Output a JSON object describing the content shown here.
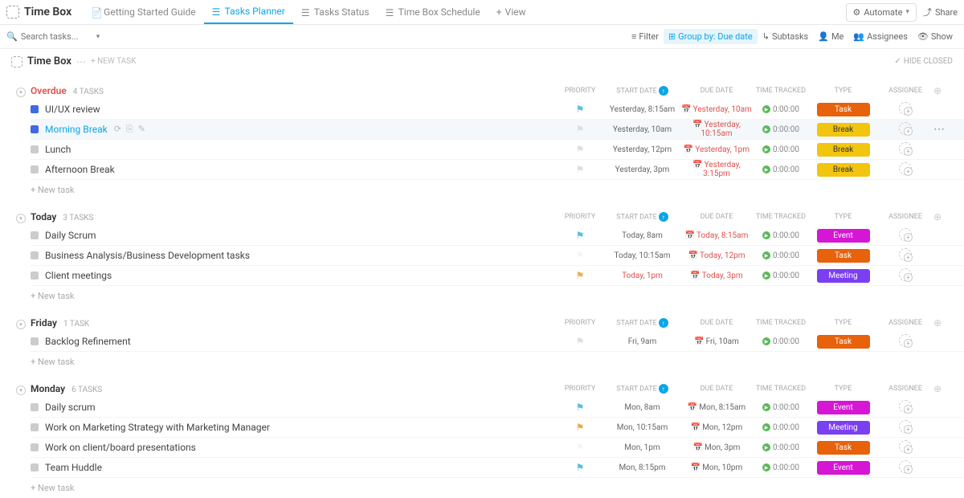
{
  "header": {
    "space_title": "Time Box",
    "tabs": [
      {
        "label": "Getting Started Guide"
      },
      {
        "label": "Tasks Planner"
      },
      {
        "label": "Tasks Status"
      },
      {
        "label": "Time Box Schedule"
      },
      {
        "label": "View"
      }
    ],
    "automate": "Automate",
    "share": "Share"
  },
  "toolbar": {
    "search_placeholder": "Search tasks...",
    "filter": "Filter",
    "group_by": "Group by: Due date",
    "subtasks": "Subtasks",
    "me": "Me",
    "assignees": "Assignees",
    "show": "Show"
  },
  "list": {
    "title": "Time Box",
    "new_task_btn": "+ NEW TASK",
    "hide_closed": "HIDE CLOSED",
    "columns": {
      "priority": "PRIORITY",
      "start_date": "START DATE",
      "due_date": "DUE DATE",
      "time_tracked": "TIME TRACKED",
      "type": "TYPE",
      "assignee": "ASSIGNEE"
    }
  },
  "new_task_label": "+ New task",
  "groups": [
    {
      "name": "Overdue",
      "klass": "overdue",
      "count": "4 TASKS",
      "tasks": [
        {
          "title": "UI/UX review",
          "status": "blue",
          "flag": "cyan",
          "start": "Yesterday, 8:15am",
          "sklass": "",
          "due": "Yesterday, 10am",
          "dklass": "red",
          "tt": "0:00:00",
          "type": "Task",
          "typeklass": "task"
        },
        {
          "title": "Morning Break",
          "status": "blue",
          "flag": "grey",
          "start": "Yesterday, 10am",
          "sklass": "",
          "due": "Yesterday, 10:15am",
          "dklass": "red",
          "tt": "0:00:00",
          "type": "Break",
          "typeklass": "break",
          "selected": true,
          "actions": true
        },
        {
          "title": "Lunch",
          "status": "",
          "flag": "grey",
          "start": "Yesterday, 12pm",
          "sklass": "",
          "due": "Yesterday, 1pm",
          "dklass": "red",
          "tt": "0:00:00",
          "type": "Break",
          "typeklass": "break"
        },
        {
          "title": "Afternoon Break",
          "status": "",
          "flag": "grey",
          "start": "Yesterday, 3pm",
          "sklass": "",
          "due": "Yesterday, 3:15pm",
          "dklass": "red",
          "tt": "0:00:00",
          "type": "Break",
          "typeklass": "break"
        }
      ]
    },
    {
      "name": "Today",
      "klass": "",
      "count": "3 TASKS",
      "tasks": [
        {
          "title": "Daily Scrum",
          "status": "",
          "flag": "cyan",
          "start": "Today, 8am",
          "sklass": "",
          "due": "Today, 8:15am",
          "dklass": "red",
          "tt": "0:00:00",
          "type": "Event",
          "typeklass": "event"
        },
        {
          "title": "Business Analysis/Business Development tasks",
          "status": "",
          "flag": "",
          "start": "Today, 10:15am",
          "sklass": "",
          "due": "Today, 12pm",
          "dklass": "red",
          "tt": "0:00:00",
          "type": "Task",
          "typeklass": "task"
        },
        {
          "title": "Client meetings",
          "status": "",
          "flag": "yellow",
          "start": "Today, 1pm",
          "sklass": "red",
          "due": "Today, 3pm",
          "dklass": "red",
          "tt": "0:00:00",
          "type": "Meeting",
          "typeklass": "meeting"
        }
      ]
    },
    {
      "name": "Friday",
      "klass": "",
      "count": "1 TASK",
      "tasks": [
        {
          "title": "Backlog Refinement",
          "status": "",
          "flag": "grey",
          "start": "Fri, 9am",
          "sklass": "",
          "due": "Fri, 10am",
          "dklass": "",
          "tt": "0:00:00",
          "type": "Task",
          "typeklass": "task"
        }
      ]
    },
    {
      "name": "Monday",
      "klass": "",
      "count": "6 TASKS",
      "tasks": [
        {
          "title": "Daily scrum",
          "status": "",
          "flag": "cyan",
          "start": "Mon, 8am",
          "sklass": "",
          "due": "Mon, 8:15am",
          "dklass": "",
          "tt": "0:00:00",
          "type": "Event",
          "typeklass": "event"
        },
        {
          "title": "Work on Marketing Strategy with Marketing Manager",
          "status": "",
          "flag": "yellow",
          "start": "Mon, 10:15am",
          "sklass": "",
          "due": "Mon, 12pm",
          "dklass": "",
          "tt": "0:00:00",
          "type": "Meeting",
          "typeklass": "meeting"
        },
        {
          "title": "Work on client/board presentations",
          "status": "",
          "flag": "",
          "start": "Mon, 1pm",
          "sklass": "",
          "due": "Mon, 3pm",
          "dklass": "",
          "tt": "0:00:00",
          "type": "Task",
          "typeklass": "task"
        },
        {
          "title": "Team Huddle",
          "status": "",
          "flag": "cyan",
          "start": "Mon, 8:15pm",
          "sklass": "",
          "due": "Mon, 10pm",
          "dklass": "",
          "tt": "0:00:00",
          "type": "Event",
          "typeklass": "event"
        }
      ]
    }
  ]
}
